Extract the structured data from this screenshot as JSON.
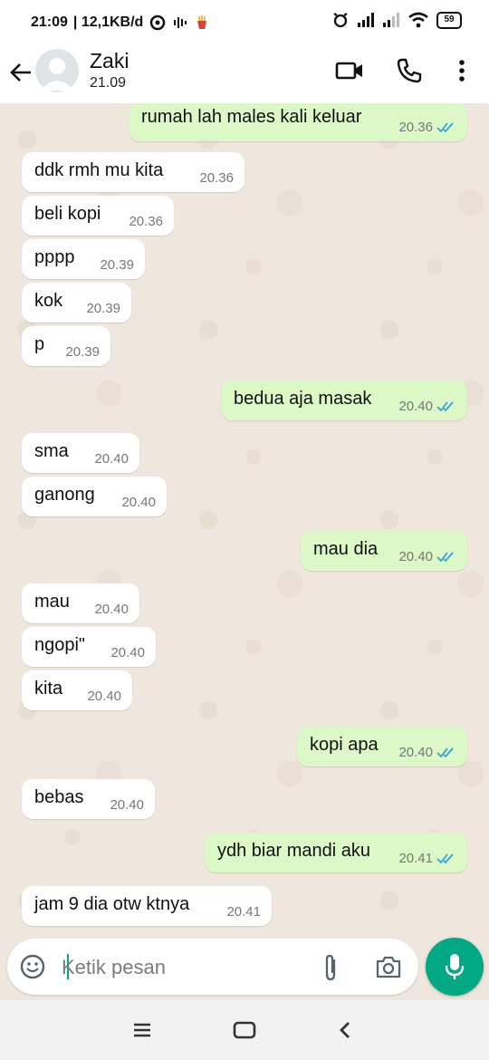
{
  "status_bar": {
    "time": "21:09",
    "network_speed": "12,1KB/d",
    "battery": "59"
  },
  "header": {
    "contact_name": "Zaki",
    "last_seen": "21.09"
  },
  "messages": [
    {
      "dir": "out",
      "text": "rumah lah males kali keluar",
      "time": "20.36"
    },
    {
      "dir": "in",
      "text": "ddk rmh mu kita",
      "time": "20.36"
    },
    {
      "dir": "in",
      "text": "beli kopi",
      "time": "20.36"
    },
    {
      "dir": "in",
      "text": "pppp",
      "time": "20.39"
    },
    {
      "dir": "in",
      "text": "kok",
      "time": "20.39"
    },
    {
      "dir": "in",
      "text": "p",
      "time": "20.39"
    },
    {
      "dir": "out",
      "text": "bedua aja masak",
      "time": "20.40"
    },
    {
      "dir": "in",
      "text": "sma",
      "time": "20.40"
    },
    {
      "dir": "in",
      "text": "ganong",
      "time": "20.40"
    },
    {
      "dir": "out",
      "text": "mau dia",
      "time": "20.40"
    },
    {
      "dir": "in",
      "text": "mau",
      "time": "20.40"
    },
    {
      "dir": "in",
      "text": "ngopi\"",
      "time": "20.40"
    },
    {
      "dir": "in",
      "text": "kita",
      "time": "20.40"
    },
    {
      "dir": "out",
      "text": "kopi apa",
      "time": "20.40"
    },
    {
      "dir": "in",
      "text": "bebas",
      "time": "20.40"
    },
    {
      "dir": "out",
      "text": "ydh biar mandi aku",
      "time": "20.41"
    },
    {
      "dir": "in",
      "text": "jam 9 dia otw ktnya",
      "time": "20.41"
    }
  ],
  "composer": {
    "placeholder": "Ketik pesan",
    "value": ""
  },
  "icons": {
    "header": [
      "back-arrow-icon",
      "video-call-icon",
      "voice-call-icon",
      "more-options-icon"
    ],
    "composer": [
      "emoji-icon",
      "attach-icon",
      "camera-icon",
      "mic-icon"
    ],
    "nav": [
      "recents-icon",
      "home-icon",
      "back-icon"
    ]
  },
  "colors": {
    "accent": "#00a884",
    "outgoing_bubble": "#dcf8c6",
    "incoming_bubble": "#ffffff",
    "read_tick": "#34a3dc",
    "chat_background": "#efe7dd"
  }
}
